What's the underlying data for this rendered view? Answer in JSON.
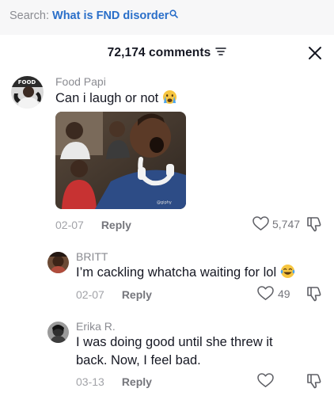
{
  "search": {
    "prefix": "Search:",
    "query": "What is FND disorder"
  },
  "header": {
    "count_label": "72,174 comments"
  },
  "comments": [
    {
      "username": "Food Papi",
      "text": "Can i laugh or not",
      "emoji": "crying-face-emoji",
      "date": "02-07",
      "reply_label": "Reply",
      "likes": "5,747",
      "has_gif": true
    },
    {
      "username": "BRITT",
      "text": "I’m cackling whatcha waiting for lol",
      "emoji": "tears-of-joy-emoji",
      "date": "02-07",
      "reply_label": "Reply",
      "likes": "49"
    },
    {
      "username": "Erika R.",
      "text_line1": "I was doing good until she threw it",
      "text_line2": "back. Now, I feel bad.",
      "date": "03-13",
      "reply_label": "Reply",
      "likes": ""
    }
  ],
  "colors": {
    "link_blue": "#2a6fc9",
    "muted_text": "#8a8b91",
    "primary_text": "#161823"
  }
}
